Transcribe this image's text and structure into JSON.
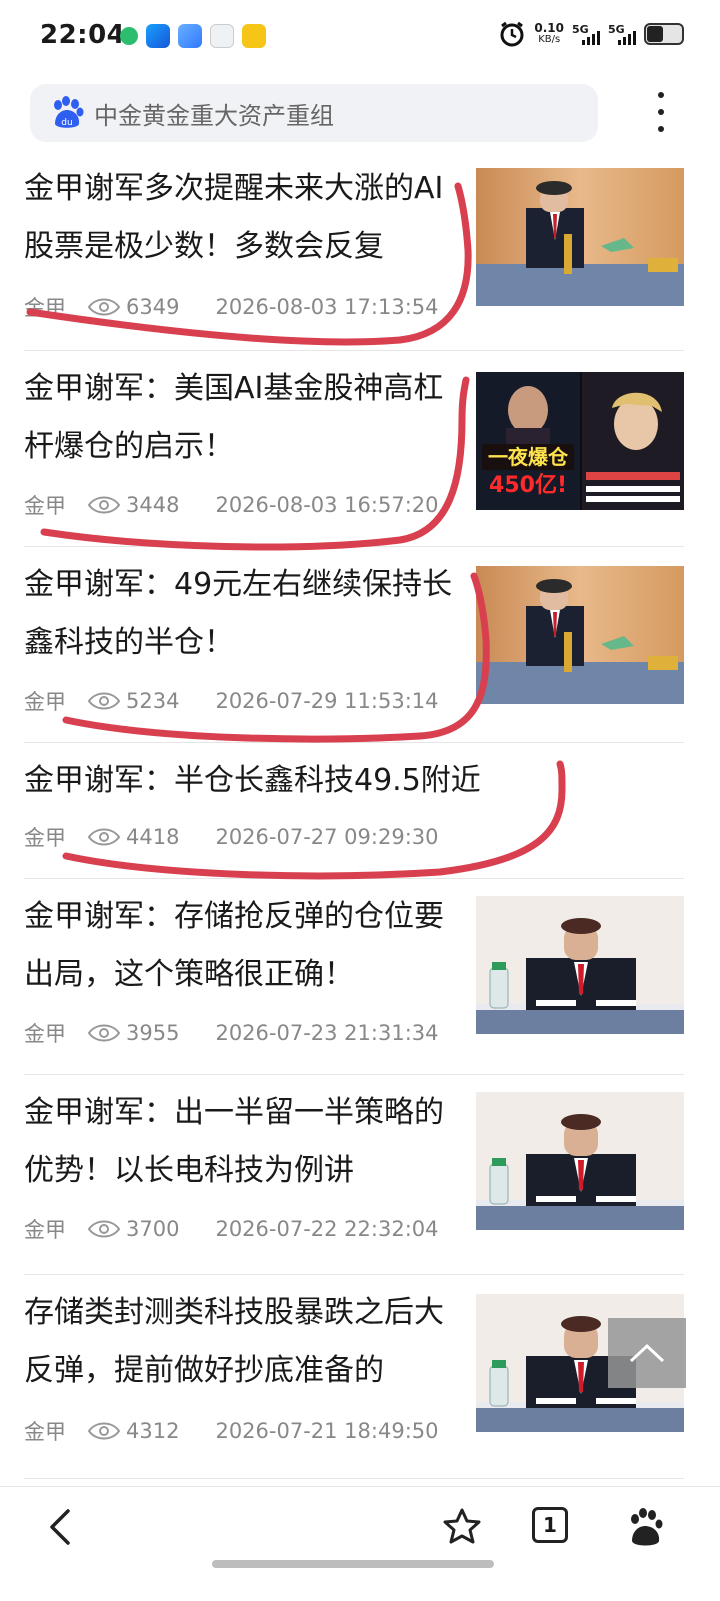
{
  "status_bar": {
    "time": "22:04",
    "net_speed": "0.10",
    "net_unit": "KB/s",
    "sim1": "5G",
    "sim2": "5G"
  },
  "search": {
    "query": "中金黄金重大资产重组",
    "logo_text": "du"
  },
  "articles": [
    {
      "title": "金甲谢军多次提醒未来大涨的AI股票是极少数！多数会反复",
      "author": "金甲",
      "views": "6349",
      "date": "2026-08-03 17:13:54",
      "thumbnail": "man-in-cap-at-desk"
    },
    {
      "title": "金甲谢军：美国AI基金股神高杠杆爆仓的启示！",
      "author": "金甲",
      "views": "3448",
      "date": "2026-08-03 16:57:20",
      "thumbnail": "ai-fund-liquidation-poster",
      "thumb_text_main": "一夜爆仓",
      "thumb_text_amount": "450亿!"
    },
    {
      "title": "金甲谢军：49元左右继续保持长鑫科技的半仓！",
      "author": "金甲",
      "views": "5234",
      "date": "2026-07-29 11:53:14",
      "thumbnail": "man-in-cap-at-desk"
    },
    {
      "title": "金甲谢军：半仓长鑫科技49.5附近",
      "author": "金甲",
      "views": "4418",
      "date": "2026-07-27 09:29:30"
    },
    {
      "title": "金甲谢军：存储抢反弹的仓位要出局，这个策略很正确！",
      "author": "金甲",
      "views": "3955",
      "date": "2026-07-23 21:31:34",
      "thumbnail": "man-at-conference-table"
    },
    {
      "title": "金甲谢军：出一半留一半策略的优势！以长电科技为例讲",
      "author": "金甲",
      "views": "3700",
      "date": "2026-07-22 22:32:04",
      "thumbnail": "man-at-conference-table"
    },
    {
      "title": "存储类封测类科技股暴跌之后大反弹，提前做好抄底准备的",
      "author": "金甲",
      "views": "4312",
      "date": "2026-07-21 18:49:50",
      "thumbnail": "man-at-conference-table"
    }
  ],
  "annotation_color": "#d9404f",
  "bottom_nav": {
    "tab_count": "1",
    "icons": [
      "back-icon",
      "star-icon",
      "tabs-icon",
      "baidu-paw-icon"
    ]
  }
}
